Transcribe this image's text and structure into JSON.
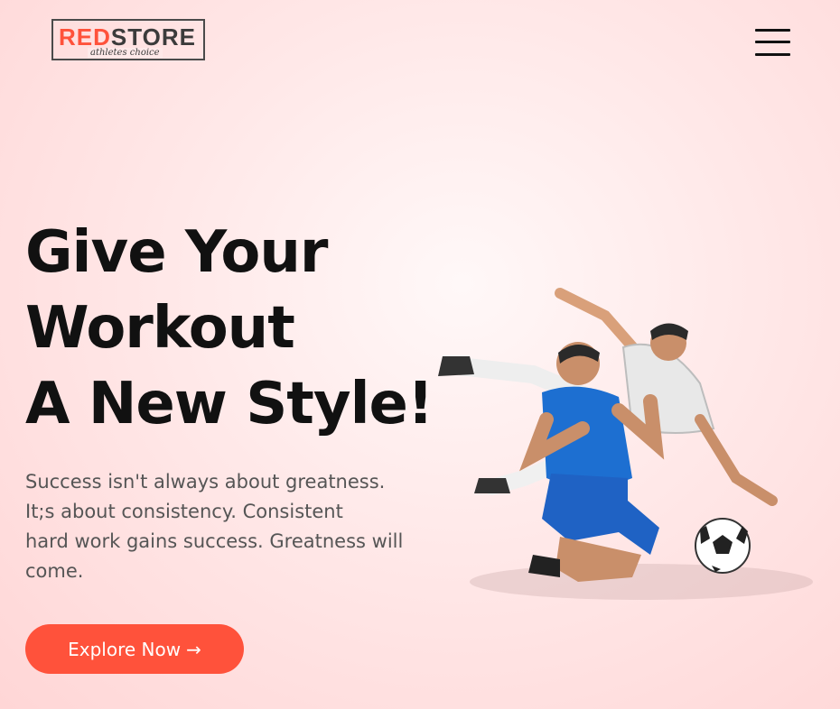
{
  "header": {
    "logo": {
      "part1": "RED",
      "part2": "STORE",
      "tagline": "athletes choice"
    },
    "menu_icon": "hamburger-menu-icon"
  },
  "hero": {
    "headline_lines": [
      "Give Your",
      "Workout",
      "A New Style!"
    ],
    "description_lines": [
      "Success isn't always about greatness.",
      "It;s about consistency. Consistent",
      "hard work gains success. Greatness will",
      "come."
    ],
    "button_label": "Explore Now",
    "button_arrow": "→",
    "image": "football-players-image"
  },
  "colors": {
    "accent": "#ff523b",
    "heading": "#111111",
    "text": "#555555",
    "background": "#ffd6d6"
  }
}
